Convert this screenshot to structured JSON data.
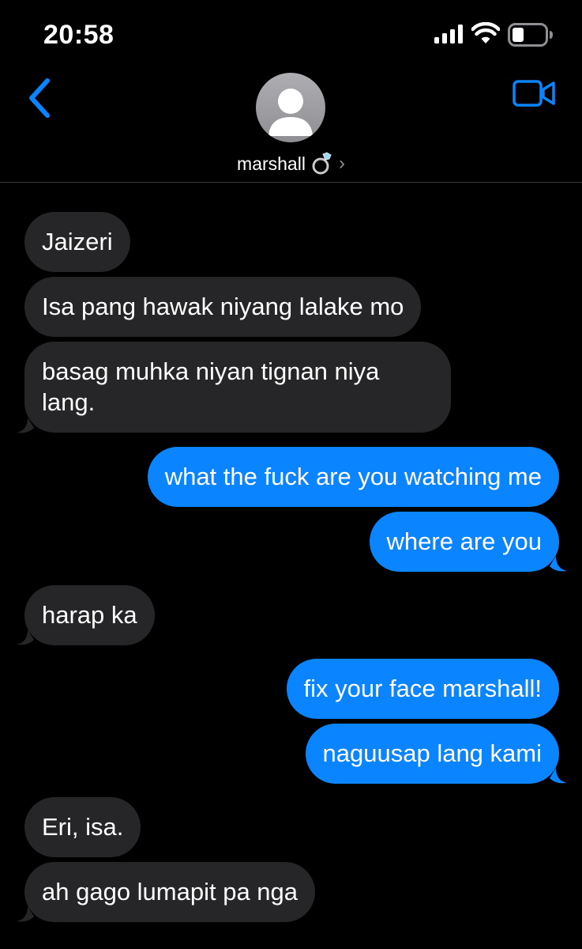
{
  "status_bar": {
    "time": "20:58",
    "icons": [
      "signal-icon",
      "wifi-icon",
      "battery-icon"
    ]
  },
  "header": {
    "back_icon": "chevron-left-icon",
    "contact_name": "marshall",
    "contact_emoji": "ring-icon",
    "video_icon": "video-camera-icon"
  },
  "messages": [
    {
      "direction": "incoming",
      "text": "Jaizeri"
    },
    {
      "direction": "incoming",
      "text": "Isa pang hawak niyang lalake mo"
    },
    {
      "direction": "incoming",
      "text": "basag muhka niyan tignan niya lang."
    },
    {
      "direction": "outgoing",
      "text": "what the fuck are you watching me"
    },
    {
      "direction": "outgoing",
      "text": "where are you"
    },
    {
      "direction": "incoming",
      "text": "harap ka"
    },
    {
      "direction": "outgoing",
      "text": "fix your face marshall!"
    },
    {
      "direction": "outgoing",
      "text": "naguusap lang kami"
    },
    {
      "direction": "incoming",
      "text": "Eri, isa."
    },
    {
      "direction": "incoming",
      "text": "ah gago lumapit pa nga"
    }
  ],
  "colors": {
    "background": "#000000",
    "incoming_bubble": "#262629",
    "outgoing_bubble": "#0a84ff",
    "accent": "#0a84ff"
  }
}
